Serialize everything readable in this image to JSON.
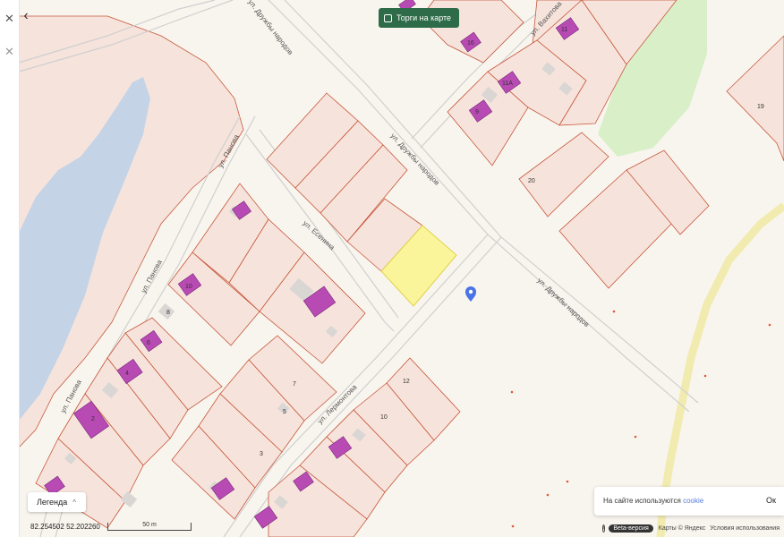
{
  "sidebar": {
    "close_glyph": "✕"
  },
  "panel": {
    "collapse_glyph": "‹"
  },
  "toolbar": {
    "torgi_label": "Торги на карте"
  },
  "legend": {
    "label": "Легенда",
    "chevron": "^"
  },
  "coordinates": {
    "lon": "82.254502",
    "lat": "52.202260"
  },
  "scale": {
    "label": "50 m"
  },
  "cookie": {
    "text": "На сайте используются",
    "link": "cookie",
    "ok": "Ок"
  },
  "footer": {
    "beta": "Beta-версия",
    "maps": "Карты © Яндекс",
    "terms": "Условия использования"
  },
  "map": {
    "streets": [
      "ул. Дружбы народов",
      "ул. Дружбы народов",
      "ул. Дружбы народов",
      "ул. Вахитова",
      "ул. Панова",
      "ул. Панова",
      "ул. Панова",
      "ул. Есенина",
      "ул. Лермонтова"
    ],
    "numbers": [
      "16",
      "11",
      "11А",
      "9",
      "19",
      "20",
      "10",
      "8",
      "6",
      "4",
      "2",
      "7",
      "5",
      "3",
      "12",
      "10"
    ],
    "colors": {
      "background": "#f8f5ee",
      "parcel_fill": "#f6e4dc",
      "parcel_stroke": "#c8563a",
      "water": "#c5d3e6",
      "greenery": "#d9efc8",
      "selected_parcel": "#faf59a",
      "building": "#b84ab4",
      "marker": "#4a73e8",
      "road_yellow": "#f2ebb0"
    }
  }
}
